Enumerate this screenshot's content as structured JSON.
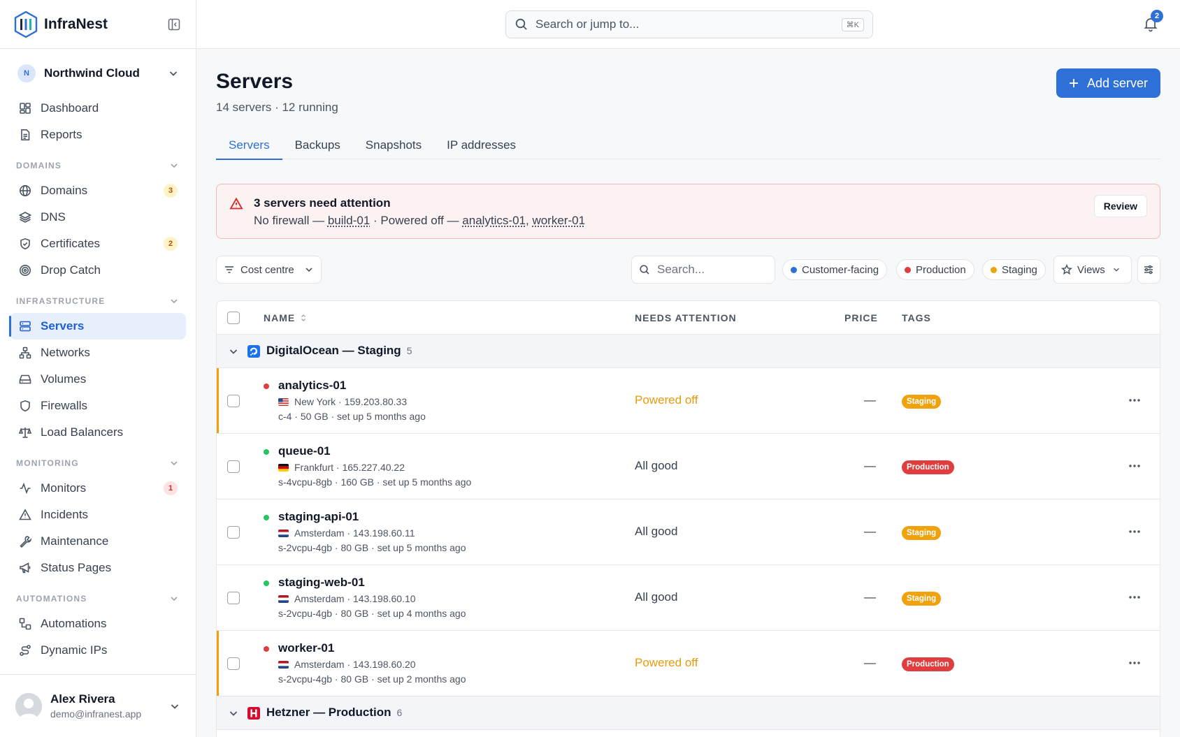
{
  "app": {
    "brand": "InfraNest",
    "org": {
      "initial": "N",
      "name": "Northwind Cloud"
    }
  },
  "search": {
    "placeholder": "Search or jump to...",
    "shortcut": "⌘K"
  },
  "notifications": {
    "count": "2"
  },
  "sidebar": {
    "top": [
      {
        "label": "Dashboard",
        "icon": "dashboard-icon"
      },
      {
        "label": "Reports",
        "icon": "file-icon"
      }
    ],
    "sections": [
      {
        "title": "DOMAINS",
        "items": [
          {
            "label": "Domains",
            "icon": "globe-icon",
            "badge": "3",
            "badge_tone": "amber"
          },
          {
            "label": "DNS",
            "icon": "layers-icon"
          },
          {
            "label": "Certificates",
            "icon": "shield-check-icon",
            "badge": "2",
            "badge_tone": "amber"
          },
          {
            "label": "Drop Catch",
            "icon": "target-icon"
          }
        ]
      },
      {
        "title": "INFRASTRUCTURE",
        "items": [
          {
            "label": "Servers",
            "icon": "server-icon",
            "active": true
          },
          {
            "label": "Networks",
            "icon": "network-icon"
          },
          {
            "label": "Volumes",
            "icon": "drive-icon"
          },
          {
            "label": "Firewalls",
            "icon": "shield-icon"
          },
          {
            "label": "Load Balancers",
            "icon": "scale-icon"
          }
        ]
      },
      {
        "title": "MONITORING",
        "items": [
          {
            "label": "Monitors",
            "icon": "activity-icon",
            "badge": "1",
            "badge_tone": "red"
          },
          {
            "label": "Incidents",
            "icon": "alert-icon"
          },
          {
            "label": "Maintenance",
            "icon": "wrench-icon"
          },
          {
            "label": "Status Pages",
            "icon": "megaphone-icon"
          }
        ]
      },
      {
        "title": "AUTOMATIONS",
        "items": [
          {
            "label": "Automations",
            "icon": "workflow-icon"
          },
          {
            "label": "Dynamic IPs",
            "icon": "route-icon"
          }
        ]
      }
    ]
  },
  "user": {
    "name": "Alex Rivera",
    "email": "demo@infranest.app"
  },
  "page": {
    "title": "Servers",
    "subtitle": "14 servers · 12 running",
    "add_label": "Add server",
    "tabs": [
      "Servers",
      "Backups",
      "Snapshots",
      "IP addresses"
    ]
  },
  "alert": {
    "title": "3 servers need attention",
    "prefix1": "No firewall — ",
    "link1": "build-01",
    "prefix2": " · Powered off — ",
    "link2": "analytics-01",
    "sep": ", ",
    "link3": "worker-01",
    "button": "Review"
  },
  "filters": {
    "cost_centre": "Cost centre",
    "search_placeholder": "Search...",
    "pills": [
      {
        "label": "Customer-facing",
        "color": "#2f6fd8"
      },
      {
        "label": "Production",
        "color": "#e03e3e"
      },
      {
        "label": "Staging",
        "color": "#f0a20c"
      }
    ],
    "views": "Views"
  },
  "table": {
    "headers": {
      "name": "NAME",
      "attention": "NEEDS ATTENTION",
      "price": "PRICE",
      "tags": "TAGS"
    },
    "groups": [
      {
        "name": "DigitalOcean — Staging",
        "count": "5",
        "provider": "digitalocean",
        "rows": [
          {
            "name": "analytics-01",
            "status": "stopped",
            "flag": "us",
            "loc": "New York · 159.203.80.33",
            "spec": "c-4 · 50 GB · set up 5 months ago",
            "attention": "Powered off",
            "attention_tone": "off",
            "price": "—",
            "tag": "Staging",
            "tag_tone": "staging"
          },
          {
            "name": "queue-01",
            "status": "running",
            "flag": "de",
            "loc": "Frankfurt · 165.227.40.22",
            "spec": "s-4vcpu-8gb · 160 GB · set up 5 months ago",
            "attention": "All good",
            "attention_tone": "ok",
            "price": "—",
            "tag": "Production",
            "tag_tone": "production"
          },
          {
            "name": "staging-api-01",
            "status": "running",
            "flag": "nl",
            "loc": "Amsterdam · 143.198.60.11",
            "spec": "s-2vcpu-4gb · 80 GB · set up 5 months ago",
            "attention": "All good",
            "attention_tone": "ok",
            "price": "—",
            "tag": "Staging",
            "tag_tone": "staging"
          },
          {
            "name": "staging-web-01",
            "status": "running",
            "flag": "nl",
            "loc": "Amsterdam · 143.198.60.10",
            "spec": "s-2vcpu-4gb · 80 GB · set up 4 months ago",
            "attention": "All good",
            "attention_tone": "ok",
            "price": "—",
            "tag": "Staging",
            "tag_tone": "staging"
          },
          {
            "name": "worker-01",
            "status": "stopped",
            "flag": "nl",
            "loc": "Amsterdam · 143.198.60.20",
            "spec": "s-2vcpu-4gb · 80 GB · set up 2 months ago",
            "attention": "Powered off",
            "attention_tone": "off",
            "price": "—",
            "tag": "Production",
            "tag_tone": "production"
          }
        ]
      },
      {
        "name": "Hetzner — Production",
        "count": "6",
        "provider": "hetzner",
        "rows": []
      }
    ]
  }
}
